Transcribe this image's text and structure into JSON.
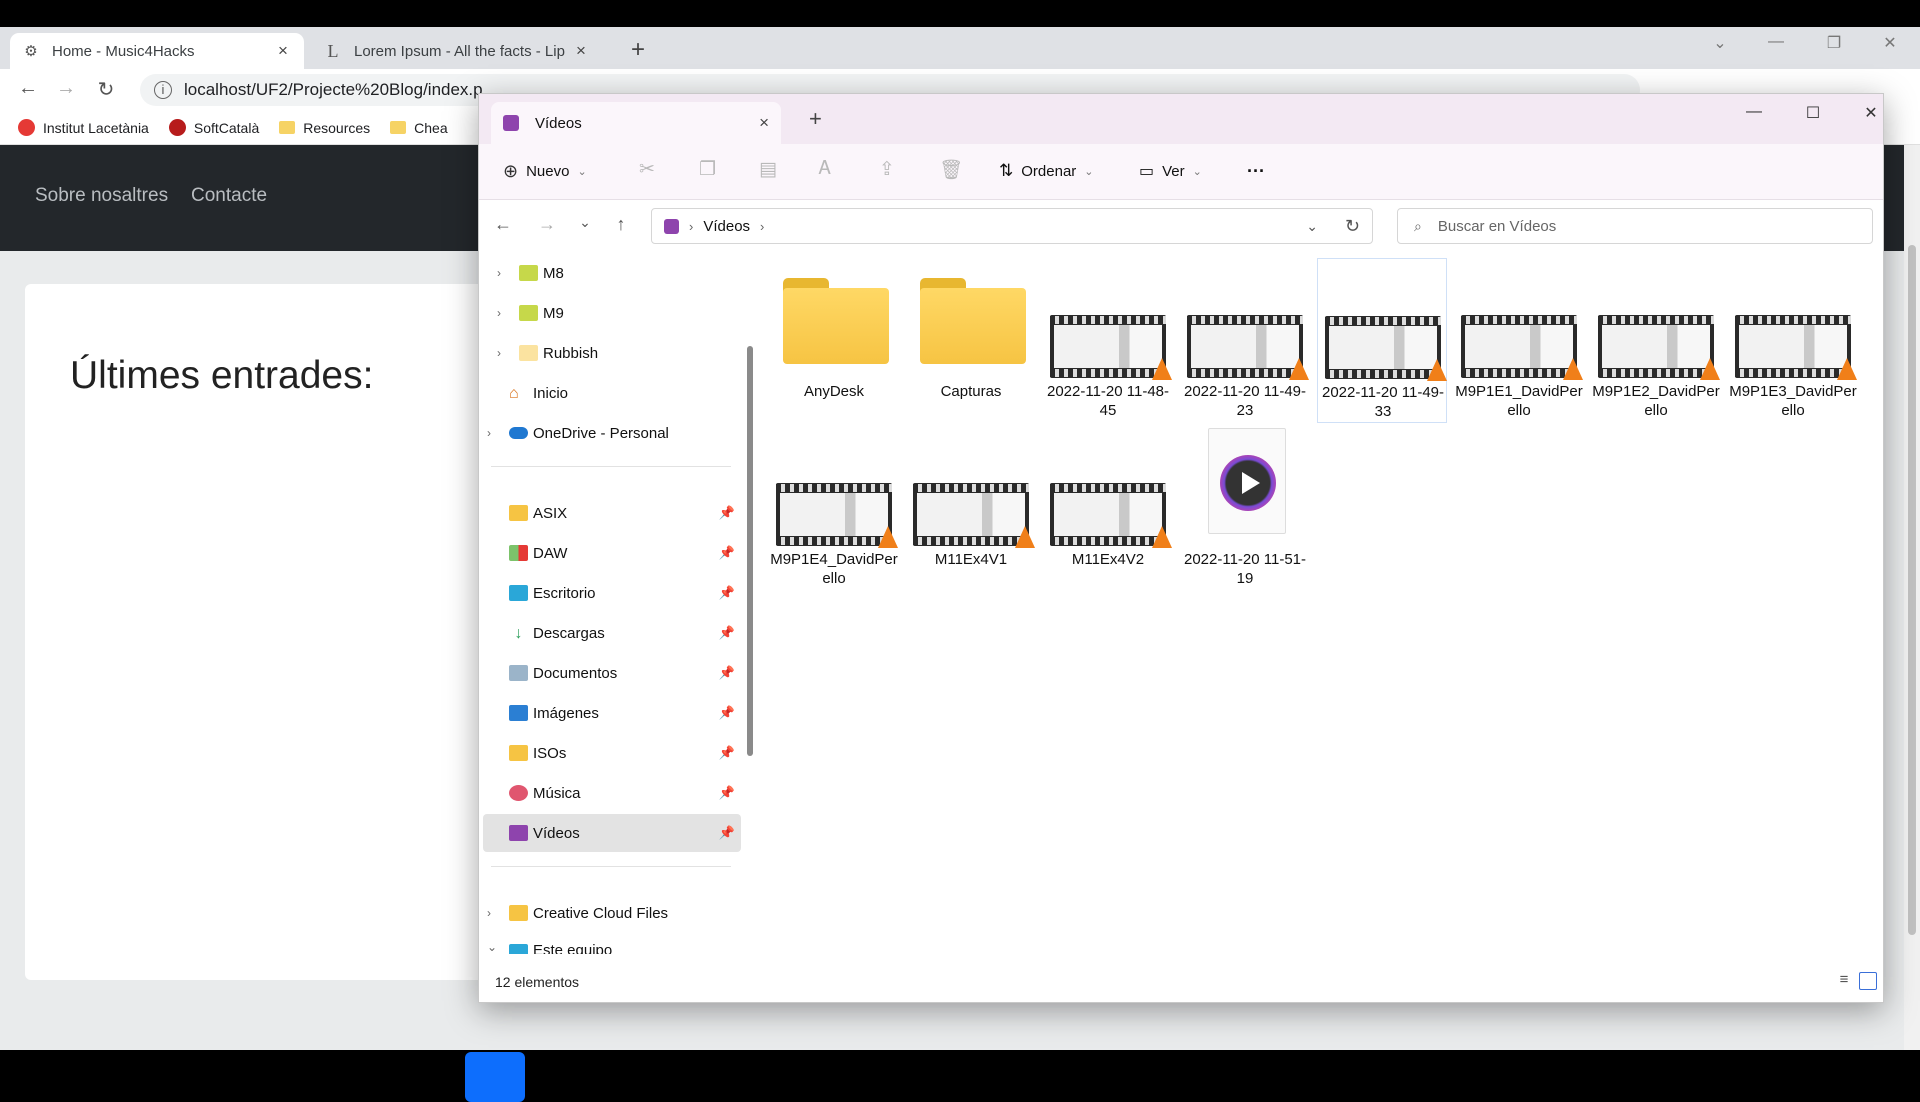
{
  "browser": {
    "tabs": [
      {
        "title": "Home - Music4Hacks",
        "close": "×"
      },
      {
        "title": "Lorem Ipsum - All the facts - Lip",
        "close": "×"
      }
    ],
    "new_tab": "+",
    "url": "localhost/UF2/Projecte%20Blog/index.p",
    "bookmarks": [
      {
        "label": "Institut Lacetània",
        "color": "#e53935"
      },
      {
        "label": "SoftCatalà",
        "color": "#b71c1c"
      },
      {
        "label": "Resources",
        "color": "#f6d365"
      },
      {
        "label": "Chea",
        "color": "#f6d365"
      }
    ]
  },
  "website": {
    "nav": [
      "Sobre nosaltres",
      "Contacte"
    ],
    "heading": "Últimes entrades:"
  },
  "explorer": {
    "tab_title": "Vídeos",
    "tab_close": "×",
    "new_tab": "+",
    "commands": {
      "new": "Nuevo",
      "sort": "Ordenar",
      "view": "Ver",
      "more": "···"
    },
    "breadcrumb": [
      "Vídeos"
    ],
    "search_placeholder": "Buscar en Vídeos",
    "nav_items": [
      {
        "label": "M8",
        "expandable": true,
        "pinned": false
      },
      {
        "label": "M9",
        "expandable": true,
        "pinned": false
      },
      {
        "label": "Rubbish",
        "expandable": true,
        "pinned": false
      },
      {
        "label": "Inicio",
        "expandable": false,
        "pinned": false
      },
      {
        "label": "OneDrive - Personal",
        "expandable": true,
        "pinned": false
      },
      {
        "label": "ASIX",
        "expandable": false,
        "pinned": true
      },
      {
        "label": "DAW",
        "expandable": false,
        "pinned": true
      },
      {
        "label": "Escritorio",
        "expandable": false,
        "pinned": true
      },
      {
        "label": "Descargas",
        "expandable": false,
        "pinned": true
      },
      {
        "label": "Documentos",
        "expandable": false,
        "pinned": true
      },
      {
        "label": "Imágenes",
        "expandable": false,
        "pinned": true
      },
      {
        "label": "ISOs",
        "expandable": false,
        "pinned": true
      },
      {
        "label": "Música",
        "expandable": false,
        "pinned": true
      },
      {
        "label": "Vídeos",
        "expandable": false,
        "pinned": true,
        "selected": true
      },
      {
        "label": "Creative Cloud Files",
        "expandable": true,
        "pinned": false
      },
      {
        "label": "Este equipo",
        "expandable": true,
        "pinned": false
      }
    ],
    "files": [
      {
        "name": "AnyDesk",
        "type": "folder"
      },
      {
        "name": "Capturas",
        "type": "folder"
      },
      {
        "name": "2022-11-20 11-48-45",
        "type": "video"
      },
      {
        "name": "2022-11-20 11-49-23",
        "type": "video"
      },
      {
        "name": "2022-11-20 11-49-33",
        "type": "video",
        "selected": true
      },
      {
        "name": "M9P1E1_DavidPerello",
        "type": "video"
      },
      {
        "name": "M9P1E2_DavidPerello",
        "type": "video"
      },
      {
        "name": "M9P1E3_DavidPerello",
        "type": "video"
      },
      {
        "name": "M9P1E4_DavidPerello",
        "type": "video"
      },
      {
        "name": "M11Ex4V1",
        "type": "video"
      },
      {
        "name": "M11Ex4V2",
        "type": "video"
      },
      {
        "name": "2022-11-20 11-51-19",
        "type": "media"
      }
    ],
    "status": "12 elementos",
    "accent": "#8e44ad",
    "folder_color": "#f6c443",
    "vlc_color": "#f07f19"
  }
}
